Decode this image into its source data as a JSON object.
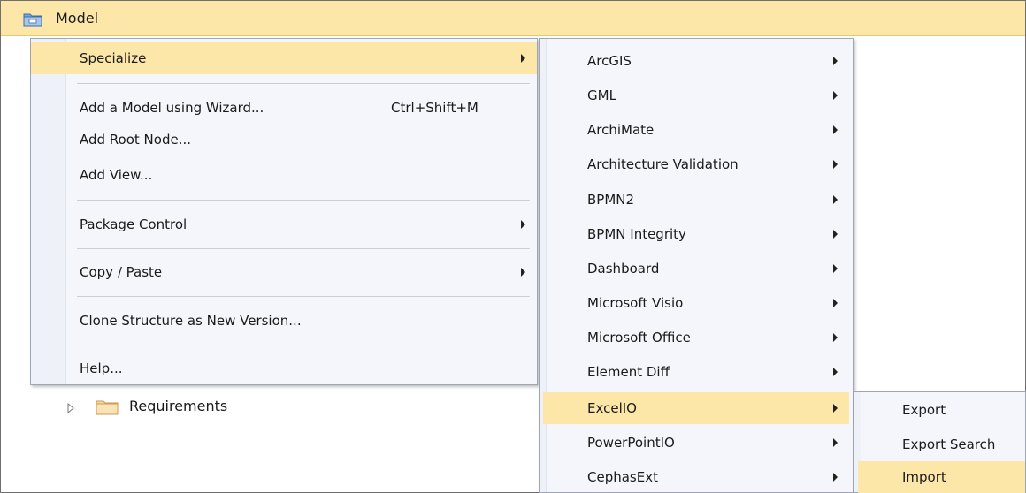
{
  "model_header": {
    "title": "Model",
    "icon": "package-folder-icon"
  },
  "tree": {
    "requirements_label": "Requirements",
    "toggle_icon": "expand-triangle-icon",
    "folder_icon": "folder-icon"
  },
  "context_menu": {
    "items": [
      {
        "label": "Specialize",
        "shortcut": "",
        "submenu": true,
        "highlighted": true
      },
      {
        "label": "Add a Model using Wizard...",
        "shortcut": "Ctrl+Shift+M",
        "submenu": false
      },
      {
        "label": "Add Root Node...",
        "shortcut": "",
        "submenu": false
      },
      {
        "label": "Add View...",
        "shortcut": "",
        "submenu": false
      },
      {
        "label": "Package Control",
        "shortcut": "",
        "submenu": true
      },
      {
        "label": "Copy / Paste",
        "shortcut": "",
        "submenu": true
      },
      {
        "label": "Clone Structure as New Version...",
        "shortcut": "",
        "submenu": false
      },
      {
        "label": "Help...",
        "shortcut": "",
        "submenu": false
      }
    ]
  },
  "specialize_menu": {
    "items": [
      {
        "label": "ArcGIS",
        "submenu": true
      },
      {
        "label": "GML",
        "submenu": true
      },
      {
        "label": "ArchiMate",
        "submenu": true
      },
      {
        "label": "Architecture Validation",
        "submenu": true
      },
      {
        "label": "BPMN2",
        "submenu": true
      },
      {
        "label": "BPMN Integrity",
        "submenu": true
      },
      {
        "label": "Dashboard",
        "submenu": true
      },
      {
        "label": "Microsoft Visio",
        "submenu": true
      },
      {
        "label": "Microsoft Office",
        "submenu": true
      },
      {
        "label": "Element Diff",
        "submenu": true
      },
      {
        "label": "ExcelIO",
        "submenu": true,
        "highlighted": true
      },
      {
        "label": "PowerPointIO",
        "submenu": true
      },
      {
        "label": "CephasExt",
        "submenu": true
      }
    ]
  },
  "excelio_menu": {
    "items": [
      {
        "label": "Export"
      },
      {
        "label": "Export Search"
      },
      {
        "label": "Import",
        "highlighted": true
      }
    ]
  },
  "colors": {
    "highlight": "#fce7a9",
    "menu_bg": "#f4f6fb",
    "menu_border": "#9ea6b3"
  }
}
